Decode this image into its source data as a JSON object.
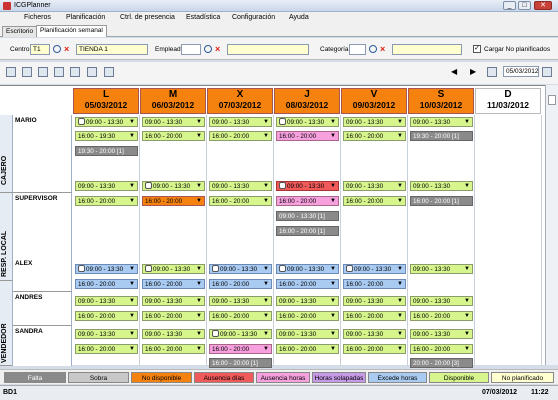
{
  "window": {
    "title": "ICGPlanner",
    "min": "_",
    "max": "□",
    "close": "✕"
  },
  "menu": [
    "Ficheros",
    "Planificación",
    "Ctrl. de presencia",
    "Estadística",
    "Configuración",
    "Ayuda"
  ],
  "tabs": [
    "Escritorio",
    "Planificación semanal"
  ],
  "filter": {
    "centro_label": "Centro",
    "centro_code": "T1",
    "centro_name": "TIENDA 1",
    "empleado_label": "Empleado",
    "categoria_label": "Categoría",
    "cargar_label": "Cargar No planificados",
    "cargar_checked": true
  },
  "nav": {
    "date": "05/03/2012"
  },
  "days": [
    {
      "letter": "L",
      "date": "05/03/2012"
    },
    {
      "letter": "M",
      "date": "06/03/2012"
    },
    {
      "letter": "X",
      "date": "07/03/2012"
    },
    {
      "letter": "J",
      "date": "08/03/2012"
    },
    {
      "letter": "V",
      "date": "09/03/2012"
    },
    {
      "letter": "S",
      "date": "10/03/2012"
    },
    {
      "letter": "D",
      "date": "11/03/2012"
    }
  ],
  "groups": [
    {
      "name": "CAJERO"
    },
    {
      "name": "RESP. LOCAL"
    },
    {
      "name": "VENDEDOR"
    }
  ],
  "employees": [
    "MARIO",
    "SUPERVISOR",
    "ALEX",
    "ANDRES",
    "SANDRA"
  ],
  "shifts": {
    "mario": [
      [
        "09:00 - 13:30",
        "16:00 - 19:30",
        "19:30 - 20:00 [1]"
      ],
      [
        "09:00 - 13:30",
        "16:00 - 20:00"
      ],
      [
        "09:00 - 13:30",
        "16:00 - 20:00"
      ],
      [
        "09:00 - 13:30",
        "16:00 - 20:00"
      ],
      [
        "09:00 - 13:30",
        "16:00 - 20:00"
      ],
      [
        "09:00 - 13:30",
        "19:30 - 20:00 [1]"
      ]
    ],
    "supervisor": [
      [
        "09:00 - 13:30",
        "16:00 - 20:00"
      ],
      [
        "09:00 - 13:30",
        "16:00 - 20:00"
      ],
      [
        "09:00 - 13:30",
        "16:00 - 20:00"
      ],
      [
        "09:00 - 13:30",
        "16:00 - 20:00",
        "09:00 - 13:30 [1]",
        "16:00 - 20:00 [1]"
      ],
      [
        "09:00 - 13:30",
        "16:00 - 20:00"
      ],
      [
        "09:00 - 13:30",
        "16:00 - 20:00 [1]"
      ]
    ],
    "alex": [
      [
        "09:00 - 13:30",
        "16:00 - 20:00"
      ],
      [
        "09:00 - 13:30",
        "16:00 - 20:00"
      ],
      [
        "09:00 - 13:30",
        "16:00 - 20:00"
      ],
      [
        "09:00 - 13:30",
        "16:00 - 20:00"
      ],
      [
        "09:00 - 13:30",
        "16:00 - 20:00"
      ],
      [
        "09:00 - 13:30"
      ]
    ],
    "andres": [
      [
        "09:00 - 13:30",
        "16:00 - 20:00"
      ],
      [
        "09:00 - 13:30",
        "16:00 - 20:00"
      ],
      [
        "09:00 - 13:30",
        "16:00 - 20:00"
      ],
      [
        "09:00 - 13:30",
        "16:00 - 20:00"
      ],
      [
        "09:00 - 13:30",
        "16:00 - 20:00"
      ],
      [
        "09:00 - 13:30",
        "16:00 - 20:00"
      ]
    ],
    "sandra": [
      [
        "09:00 - 13:30",
        "16:00 - 20:00"
      ],
      [
        "09:00 - 13:30",
        "16:00 - 20:00"
      ],
      [
        "09:00 - 13:30",
        "16:00 - 20:00",
        "16:00 - 20:00 [1]"
      ],
      [
        "09:00 - 13:30",
        "16:00 - 20:00"
      ],
      [
        "09:00 - 13:30",
        "16:00 - 20:00"
      ],
      [
        "09:00 - 13:30",
        "16:00 - 20:00",
        "20:00 - 20:00 [3]"
      ]
    ]
  },
  "legend": [
    "Falta",
    "Sobra",
    "No disponible",
    "Ausencia días",
    "Ausencia horas",
    "Horas solapadas",
    "Excede horas",
    "Disponible",
    "No planificado"
  ],
  "legend_colors": [
    "#8a8a8a",
    "#c8c8c8",
    "#f5820f",
    "#f05a5a",
    "#f6a0de",
    "#c79ae8",
    "#a9cbf2",
    "#d6f58c",
    "#ffffd0"
  ],
  "status": {
    "db": "BD1",
    "date": "07/03/2012",
    "time": "11:22"
  }
}
